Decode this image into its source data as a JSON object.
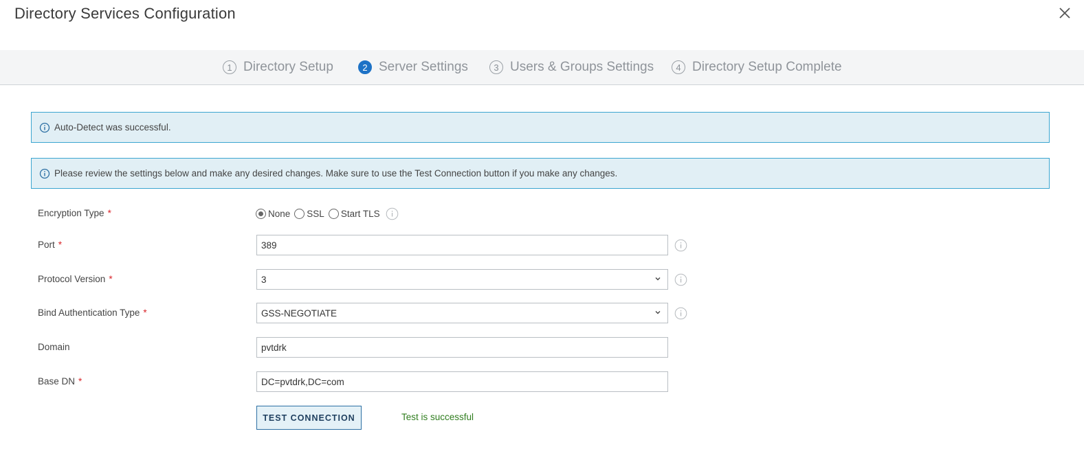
{
  "dialog": {
    "title": "Directory Services Configuration"
  },
  "steps": [
    {
      "num": "1",
      "label": "Directory Setup",
      "active": false
    },
    {
      "num": "2",
      "label": "Server Settings",
      "active": true
    },
    {
      "num": "3",
      "label": "Users & Groups Settings",
      "active": false
    },
    {
      "num": "4",
      "label": "Directory Setup Complete",
      "active": false
    }
  ],
  "alerts": {
    "autodetect": "Auto-Detect was successful.",
    "review": "Please review the settings below and make any desired changes. Make sure to use the Test Connection button if you make any changes."
  },
  "form": {
    "encryption": {
      "label": "Encryption Type",
      "options": [
        "None",
        "SSL",
        "Start TLS"
      ],
      "selected": "None"
    },
    "port": {
      "label": "Port",
      "value": "389"
    },
    "protocol": {
      "label": "Protocol Version",
      "value": "3"
    },
    "bind_auth": {
      "label": "Bind Authentication Type",
      "value": "GSS-NEGOTIATE"
    },
    "domain": {
      "label": "Domain",
      "value": "pvtdrk"
    },
    "base_dn": {
      "label": "Base DN",
      "value": "DC=pvtdrk,DC=com"
    },
    "required_mark": "*"
  },
  "actions": {
    "test_connection": "TEST CONNECTION",
    "test_status": "Test is successful"
  },
  "colors": {
    "accent": "#1d72c6",
    "alert_bg": "#e1eff5",
    "alert_border": "#3aa5d0",
    "required": "#d9252a",
    "success": "#2f7d1e"
  }
}
